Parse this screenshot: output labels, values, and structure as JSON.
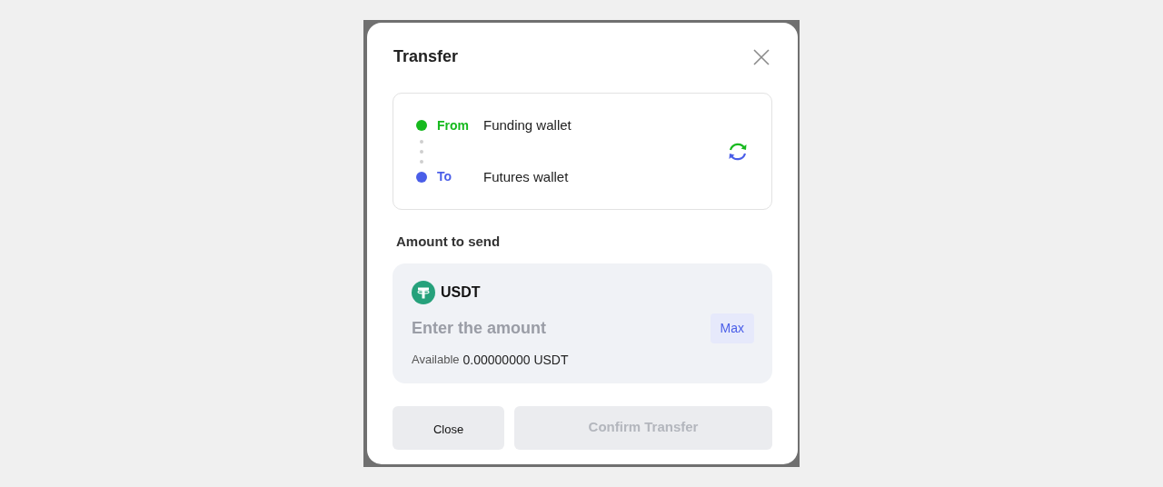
{
  "dialog": {
    "title": "Transfer"
  },
  "route": [
    {
      "label": "From",
      "wallet": "Funding wallet",
      "color": "#16b91e"
    },
    {
      "label": "To",
      "wallet": "Futures wallet",
      "color": "#4a5ee8"
    }
  ],
  "amount": {
    "label": "Amount to send",
    "currency": "USDT",
    "placeholder": "Enter the amount",
    "max_button": "Max",
    "available_label": "Available",
    "available_value": "0.00000000 USDT"
  },
  "buttons": [
    {
      "label": "Close",
      "disabled": false
    },
    {
      "label": "Confirm Transfer",
      "disabled": true
    }
  ]
}
